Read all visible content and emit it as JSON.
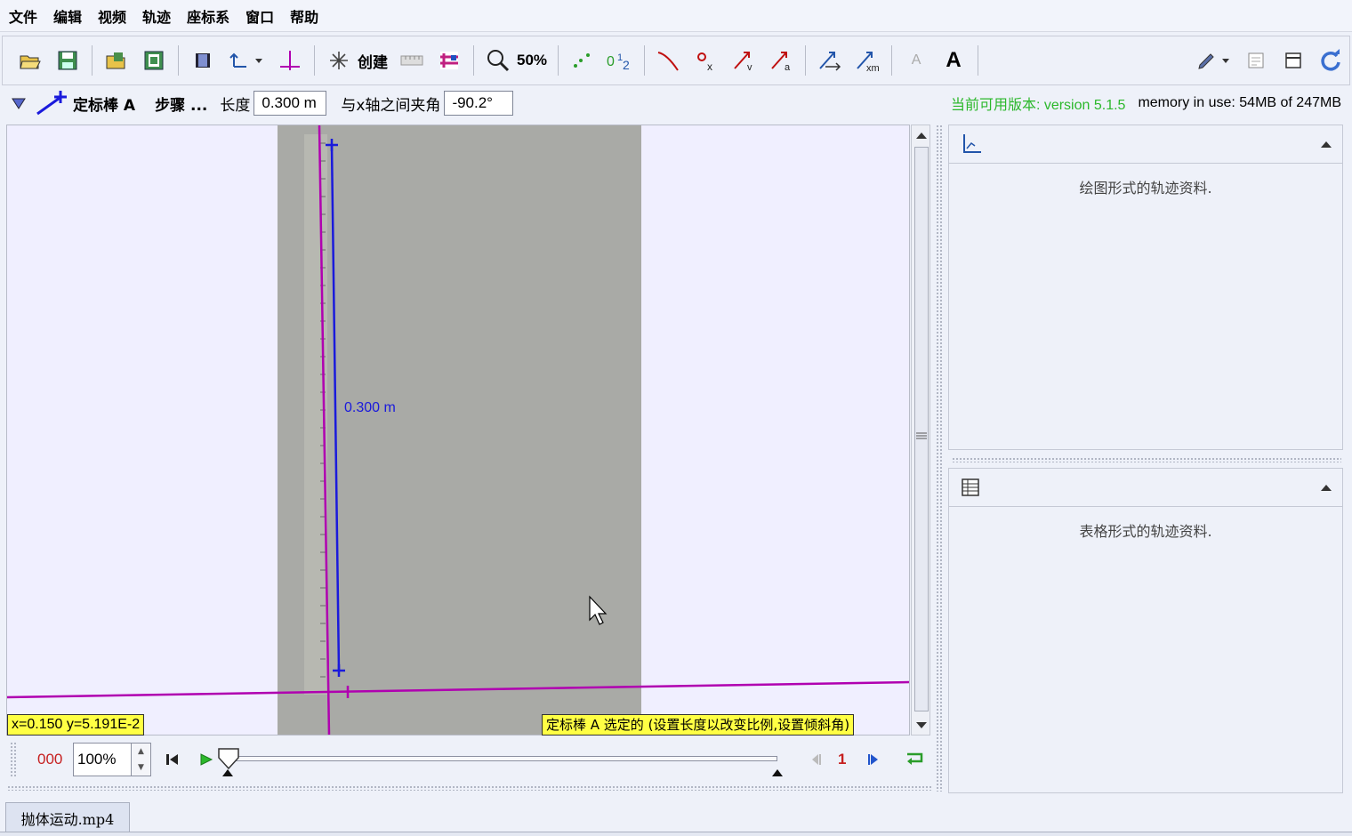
{
  "menu": [
    "文件",
    "编辑",
    "视频",
    "轨迹",
    "座标系",
    "窗口",
    "帮助"
  ],
  "toolbar": {
    "create_label": "创建",
    "zoom_label": "50%",
    "font_small": "A",
    "font_large": "A"
  },
  "tape": {
    "name": "定标棒 A",
    "step_label": "步骤 ...",
    "length_label": "长度",
    "length_value": "0.300 m",
    "angle_label": "与x轴之间夹角",
    "angle_value": "-90.2°"
  },
  "version": {
    "label": "当前可用版本: version 5.1.5",
    "memory": "memory in use: 54MB of 247MB"
  },
  "video": {
    "tape_readout": "0.300 m",
    "coords": "x=0.150  y=5.191E-2",
    "status": "定标棒 A 选定的 (设置长度以改变比例,设置倾斜角)"
  },
  "player": {
    "frame": "000",
    "rate": "100%",
    "step_count": "1"
  },
  "plot_panel": {
    "text": "绘图形式的轨迹资料."
  },
  "table_panel": {
    "text": "表格形式的轨迹资料."
  },
  "tab": {
    "label": "抛体运动.mp4"
  },
  "colors": {
    "axis": "#b000b0",
    "tape": "#1a1adc",
    "status_bg": "#ffff44",
    "version": "#2cb82c"
  }
}
